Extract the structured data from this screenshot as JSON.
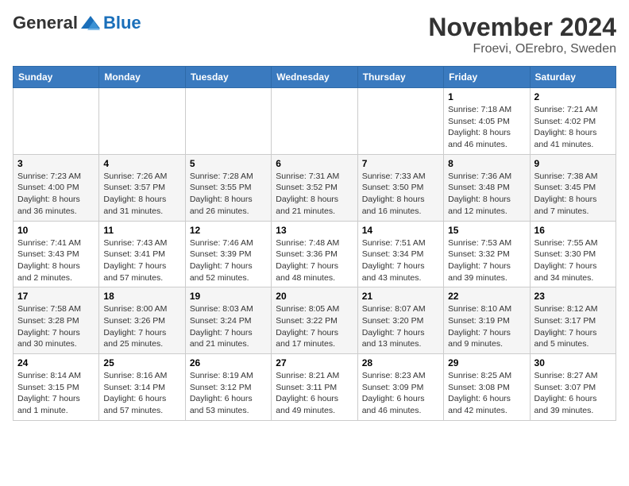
{
  "logo": {
    "general": "General",
    "blue": "Blue"
  },
  "title": "November 2024",
  "location": "Froevi, OErebro, Sweden",
  "days_of_week": [
    "Sunday",
    "Monday",
    "Tuesday",
    "Wednesday",
    "Thursday",
    "Friday",
    "Saturday"
  ],
  "weeks": [
    [
      {
        "day": "",
        "info": ""
      },
      {
        "day": "",
        "info": ""
      },
      {
        "day": "",
        "info": ""
      },
      {
        "day": "",
        "info": ""
      },
      {
        "day": "",
        "info": ""
      },
      {
        "day": "1",
        "info": "Sunrise: 7:18 AM\nSunset: 4:05 PM\nDaylight: 8 hours and 46 minutes."
      },
      {
        "day": "2",
        "info": "Sunrise: 7:21 AM\nSunset: 4:02 PM\nDaylight: 8 hours and 41 minutes."
      }
    ],
    [
      {
        "day": "3",
        "info": "Sunrise: 7:23 AM\nSunset: 4:00 PM\nDaylight: 8 hours and 36 minutes."
      },
      {
        "day": "4",
        "info": "Sunrise: 7:26 AM\nSunset: 3:57 PM\nDaylight: 8 hours and 31 minutes."
      },
      {
        "day": "5",
        "info": "Sunrise: 7:28 AM\nSunset: 3:55 PM\nDaylight: 8 hours and 26 minutes."
      },
      {
        "day": "6",
        "info": "Sunrise: 7:31 AM\nSunset: 3:52 PM\nDaylight: 8 hours and 21 minutes."
      },
      {
        "day": "7",
        "info": "Sunrise: 7:33 AM\nSunset: 3:50 PM\nDaylight: 8 hours and 16 minutes."
      },
      {
        "day": "8",
        "info": "Sunrise: 7:36 AM\nSunset: 3:48 PM\nDaylight: 8 hours and 12 minutes."
      },
      {
        "day": "9",
        "info": "Sunrise: 7:38 AM\nSunset: 3:45 PM\nDaylight: 8 hours and 7 minutes."
      }
    ],
    [
      {
        "day": "10",
        "info": "Sunrise: 7:41 AM\nSunset: 3:43 PM\nDaylight: 8 hours and 2 minutes."
      },
      {
        "day": "11",
        "info": "Sunrise: 7:43 AM\nSunset: 3:41 PM\nDaylight: 7 hours and 57 minutes."
      },
      {
        "day": "12",
        "info": "Sunrise: 7:46 AM\nSunset: 3:39 PM\nDaylight: 7 hours and 52 minutes."
      },
      {
        "day": "13",
        "info": "Sunrise: 7:48 AM\nSunset: 3:36 PM\nDaylight: 7 hours and 48 minutes."
      },
      {
        "day": "14",
        "info": "Sunrise: 7:51 AM\nSunset: 3:34 PM\nDaylight: 7 hours and 43 minutes."
      },
      {
        "day": "15",
        "info": "Sunrise: 7:53 AM\nSunset: 3:32 PM\nDaylight: 7 hours and 39 minutes."
      },
      {
        "day": "16",
        "info": "Sunrise: 7:55 AM\nSunset: 3:30 PM\nDaylight: 7 hours and 34 minutes."
      }
    ],
    [
      {
        "day": "17",
        "info": "Sunrise: 7:58 AM\nSunset: 3:28 PM\nDaylight: 7 hours and 30 minutes."
      },
      {
        "day": "18",
        "info": "Sunrise: 8:00 AM\nSunset: 3:26 PM\nDaylight: 7 hours and 25 minutes."
      },
      {
        "day": "19",
        "info": "Sunrise: 8:03 AM\nSunset: 3:24 PM\nDaylight: 7 hours and 21 minutes."
      },
      {
        "day": "20",
        "info": "Sunrise: 8:05 AM\nSunset: 3:22 PM\nDaylight: 7 hours and 17 minutes."
      },
      {
        "day": "21",
        "info": "Sunrise: 8:07 AM\nSunset: 3:20 PM\nDaylight: 7 hours and 13 minutes."
      },
      {
        "day": "22",
        "info": "Sunrise: 8:10 AM\nSunset: 3:19 PM\nDaylight: 7 hours and 9 minutes."
      },
      {
        "day": "23",
        "info": "Sunrise: 8:12 AM\nSunset: 3:17 PM\nDaylight: 7 hours and 5 minutes."
      }
    ],
    [
      {
        "day": "24",
        "info": "Sunrise: 8:14 AM\nSunset: 3:15 PM\nDaylight: 7 hours and 1 minute."
      },
      {
        "day": "25",
        "info": "Sunrise: 8:16 AM\nSunset: 3:14 PM\nDaylight: 6 hours and 57 minutes."
      },
      {
        "day": "26",
        "info": "Sunrise: 8:19 AM\nSunset: 3:12 PM\nDaylight: 6 hours and 53 minutes."
      },
      {
        "day": "27",
        "info": "Sunrise: 8:21 AM\nSunset: 3:11 PM\nDaylight: 6 hours and 49 minutes."
      },
      {
        "day": "28",
        "info": "Sunrise: 8:23 AM\nSunset: 3:09 PM\nDaylight: 6 hours and 46 minutes."
      },
      {
        "day": "29",
        "info": "Sunrise: 8:25 AM\nSunset: 3:08 PM\nDaylight: 6 hours and 42 minutes."
      },
      {
        "day": "30",
        "info": "Sunrise: 8:27 AM\nSunset: 3:07 PM\nDaylight: 6 hours and 39 minutes."
      }
    ]
  ]
}
